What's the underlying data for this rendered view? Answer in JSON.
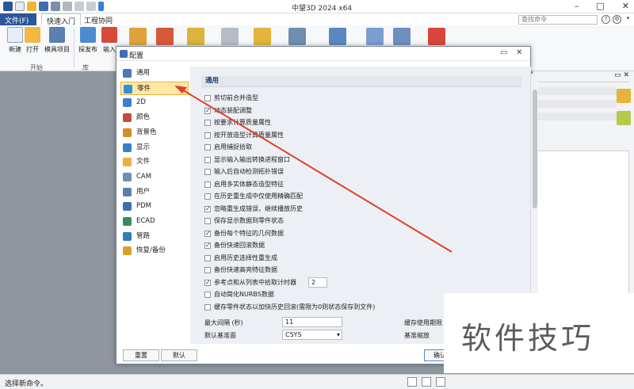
{
  "window": {
    "title": "中望3D 2024 x64",
    "controls": {
      "minimize": "–",
      "maximize": "□",
      "close": "✕"
    }
  },
  "ribbon": {
    "tabs": [
      "文件(F)",
      "快速入门",
      "工程协同"
    ],
    "search_placeholder": "查找命令",
    "help_icons": [
      "?",
      "⚙",
      "▾"
    ],
    "buttons": [
      {
        "label": "新建",
        "icon": "new-doc-icon",
        "color": "#e8eef8"
      },
      {
        "label": "打开",
        "icon": "open-folder-icon",
        "color": "#f3b840"
      },
      {
        "label": "模具项目",
        "icon": "mold-project-icon",
        "color": "#5a7fb0"
      },
      {
        "label": "探发布",
        "icon": "publish-icon",
        "color": "#4d8bd0"
      },
      {
        "label": "输入",
        "icon": "import-icon",
        "color": "#d64a3a"
      }
    ],
    "groups": [
      "开始",
      "库"
    ]
  },
  "dialog": {
    "title": "配置",
    "controls": {
      "restore": "▭",
      "close": "✕"
    },
    "nav": [
      {
        "label": "通用",
        "icon": "general-icon",
        "color": "#4a78b8"
      },
      {
        "label": "零件",
        "icon": "part-icon",
        "color": "#2f8fd8",
        "selected": true
      },
      {
        "label": "2D",
        "icon": "2d-icon",
        "color": "#3b7ecf"
      },
      {
        "label": "颜色",
        "icon": "color-icon",
        "color": "#c94a3a"
      },
      {
        "label": "背景色",
        "icon": "background-color-icon",
        "color": "#d88a2a"
      },
      {
        "label": "显示",
        "icon": "display-icon",
        "color": "#3a7fc4"
      },
      {
        "label": "文件",
        "icon": "file-icon",
        "color": "#e8b33a"
      },
      {
        "label": "CAM",
        "icon": "cam-icon",
        "color": "#6e8fae"
      },
      {
        "label": "用户",
        "icon": "user-icon",
        "color": "#5a7fae"
      },
      {
        "label": "PDM",
        "icon": "pdm-icon",
        "color": "#3c6fb0"
      },
      {
        "label": "ECAD",
        "icon": "ecad-icon",
        "color": "#3c8a5a"
      },
      {
        "label": "管路",
        "icon": "piping-icon",
        "color": "#2f7fb4"
      },
      {
        "label": "恢复/备份",
        "icon": "restore-backup-icon",
        "color": "#d8a02a"
      }
    ],
    "section_title": "通用",
    "options": [
      {
        "label": "剪切前合并造型",
        "checked": false
      },
      {
        "label": "动态装配调整",
        "checked": true
      },
      {
        "label": "按要求计算质量属性",
        "checked": false
      },
      {
        "label": "按开放造型计算质量属性",
        "checked": false
      },
      {
        "label": "启用捕捉拾取",
        "checked": false
      },
      {
        "label": "显示输入输出转换进程窗口",
        "checked": false
      },
      {
        "label": "输入后自动检测拓扑错误",
        "checked": false
      },
      {
        "label": "启用多实体静态造型特征",
        "checked": false
      },
      {
        "label": "在历史重生成中仅使用精确匹配",
        "checked": false
      },
      {
        "label": "忽略重生成错误，继续播放历史",
        "checked": true
      },
      {
        "label": "保存显示数据到零件状态",
        "checked": false
      },
      {
        "label": "备份每个特征的几何数据",
        "checked": true
      },
      {
        "label": "备份快速回滚数据",
        "checked": true
      },
      {
        "label": "启用历史选择性重生成",
        "checked": false
      },
      {
        "label": "备份快速高亮特征数据",
        "checked": false
      },
      {
        "label": "参考点和从列表中拾取计时器",
        "checked": true,
        "spinner_value": "2"
      },
      {
        "label": "自动简化NURBS数据",
        "checked": false
      },
      {
        "label": "缓存零件状态以加快历史回滚(需限为0则状态保存到文件)",
        "checked": false
      }
    ],
    "fields": {
      "max_interval_label": "最大间隔 (秒)",
      "max_interval_value": "11",
      "default_plane_label": "默认基准面",
      "default_plane_value": "CSYS",
      "cache_label": "缓存使用期限 (",
      "datum_scale_label": "基准缩放"
    },
    "buttons": {
      "reset": "重置",
      "default": "默认",
      "ok": "确认"
    }
  },
  "status_bar": {
    "message": "选择新命令。"
  },
  "watermark": "软件技巧",
  "arrow_color": "#e0402a"
}
